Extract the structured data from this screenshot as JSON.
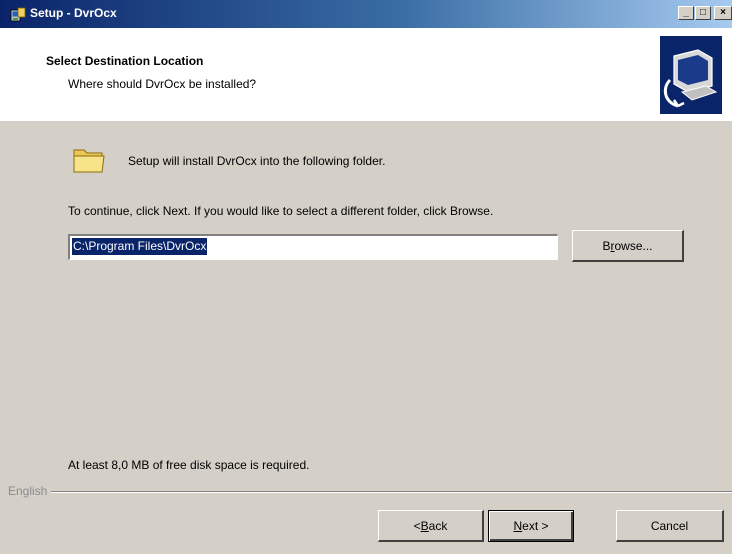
{
  "window": {
    "title": "Setup - DvrOcx",
    "controls": {
      "minimize": "_",
      "maximize": "□",
      "close": "×"
    }
  },
  "header": {
    "title": "Select Destination Location",
    "subtitle": "Where should DvrOcx be installed?",
    "image": "computer-install-icon"
  },
  "body": {
    "intro": "Setup will install DvrOcx into the following folder.",
    "continue": "To continue, click Next. If you would like to select a different folder, click Browse.",
    "path_value": "C:\\Program Files\\DvrOcx",
    "browse_label_pre": "B",
    "browse_label_u": "r",
    "browse_label_post": "owse...",
    "disk_space": "At least 8,0 MB of free disk space is required."
  },
  "footer": {
    "language": "English",
    "back_pre": "< ",
    "back_u": "B",
    "back_post": "ack",
    "next_u": "N",
    "next_post": "ext >",
    "cancel": "Cancel"
  },
  "colors": {
    "titlebar_start": "#0a246a",
    "titlebar_end": "#a6caf0",
    "face": "#d4d0c8",
    "selection": "#0a246a"
  }
}
